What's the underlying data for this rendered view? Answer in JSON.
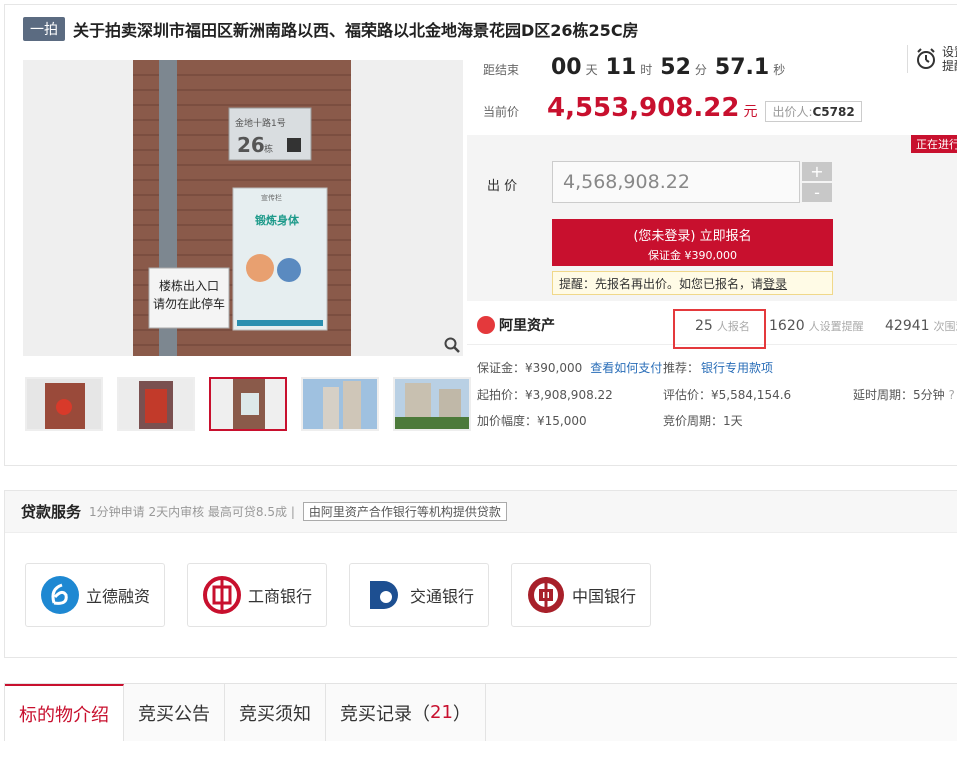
{
  "header": {
    "tag": "一拍",
    "title": "关于拍卖深圳市福田区新洲南路以西、福荣路以北金地海景花园D区26栋25C房"
  },
  "photo": {
    "sign_top_line1": "金地十路1号",
    "sign_top_line2": "26",
    "sign_top_unit": "栋",
    "poster_header": "宣传栏",
    "poster_title": "锻炼身体",
    "notice_line1": "楼栋出入口",
    "notice_line2": "请勿在此停车"
  },
  "countdown": {
    "label": "距结束",
    "days": "00",
    "days_unit": "天",
    "hours": "11",
    "hours_unit": "时",
    "minutes": "52",
    "minutes_unit": "分",
    "seconds": "57.1",
    "seconds_unit": "秒"
  },
  "remind": {
    "line1": "设置",
    "line2": "提醒"
  },
  "current_price": {
    "label": "当前价",
    "value": "4,553,908.22",
    "unit": "元",
    "bidder_label": "出价人:",
    "bidder_id": "C5782"
  },
  "bid": {
    "status": "正在进行",
    "label": "出 价",
    "value": "4,568,908.22",
    "plus": "+",
    "minus": "-",
    "signup_line1": "(您未登录) 立即报名",
    "signup_line2": "保证金 ¥390,000",
    "hint_prefix": "提醒：先报名再出价。如您已报名，请",
    "hint_login": "登录"
  },
  "stats": {
    "platform": "阿里资产",
    "signups": "25",
    "signups_label": "人报名",
    "reminders": "1620",
    "reminders_label": "人设置提醒",
    "views": "42941",
    "views_label": "次围观"
  },
  "details": {
    "deposit": "保证金：¥390,000",
    "deposit_link": "查看如何支付",
    "recommend": "推荐：",
    "recommend_link": "银行专用款项",
    "start_price": "起拍价：¥3,908,908.22",
    "appraisal": "评估价：¥5,584,154.6",
    "delay": "延时周期：5分钟",
    "increment": "加价幅度：¥15,000",
    "cycle": "竞价周期：1天"
  },
  "loan": {
    "title": "贷款服务",
    "subtitle": "1分钟申请 2天内审核 最高可贷8.5成 |",
    "tag": "由阿里资产合作银行等机构提供贷款",
    "banks": [
      "立德融资",
      "工商银行",
      "交通银行",
      "中国银行"
    ]
  },
  "tabs": {
    "intro": "标的物介绍",
    "notice": "竞买公告",
    "rules": "竞买须知",
    "records": "竞买记录（",
    "records_count": "21",
    "records_end": "）"
  },
  "colors": {
    "accent": "#c8102e",
    "tag_bg": "#5b6b81",
    "link": "#2a6eb8"
  }
}
